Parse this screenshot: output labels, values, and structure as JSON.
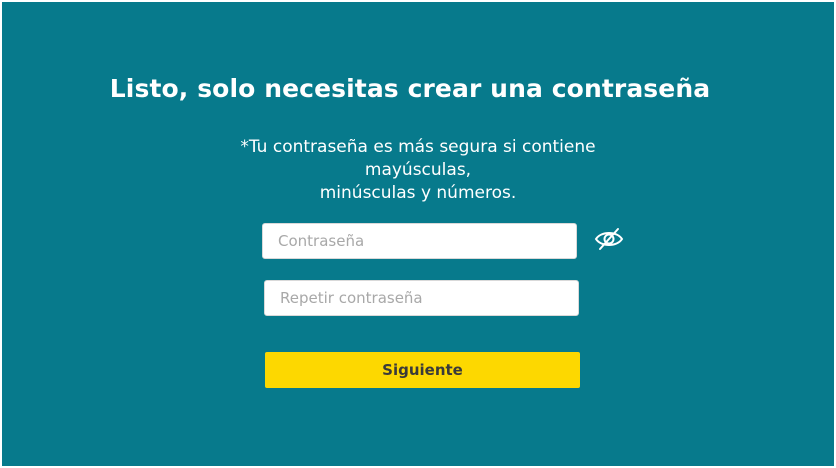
{
  "page": {
    "title": "Listo, solo necesitas crear una contraseña",
    "subtitle_line1": "*Tu contraseña es más segura si contiene mayúsculas,",
    "subtitle_line2": "minúsculas y números."
  },
  "form": {
    "password_placeholder": "Contraseña",
    "password_value": "",
    "repeat_placeholder": "Repetir contraseña",
    "repeat_value": "",
    "toggle_icon": "eye-slash-icon",
    "submit_label": "Siguiente"
  },
  "colors": {
    "background": "#077a8c",
    "button": "#fdd800",
    "text": "#ffffff"
  }
}
